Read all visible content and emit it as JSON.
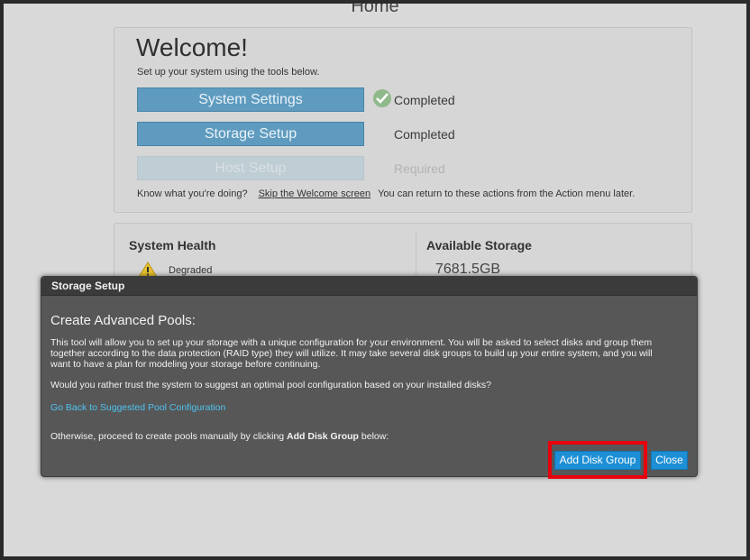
{
  "page": {
    "title": "Home"
  },
  "welcome": {
    "title": "Welcome!",
    "subtitle": "Set up your system using the tools below.",
    "actions": [
      {
        "label": "System Settings",
        "status": "Completed"
      },
      {
        "label": "Storage Setup",
        "status": "Completed"
      },
      {
        "label": "Host Setup",
        "status": "Required"
      }
    ],
    "footer": {
      "prompt": "Know what you're doing?",
      "skip_link": "Skip the Welcome screen",
      "note": "You can return to these actions from the Action menu later."
    }
  },
  "health": {
    "title": "System Health",
    "status": "Degraded"
  },
  "storage": {
    "title": "Available Storage",
    "value": "7681.5GB"
  },
  "modal": {
    "title": "Storage Setup",
    "heading": "Create Advanced Pools:",
    "paragraph": "This tool will allow you to set up your storage with a unique configuration for your environment. You will be asked to select disks and group them together according to the data protection (RAID type) they will utilize. It may take several disk groups to build up your entire system, and you will want to have a plan for modeling your storage before continuing.",
    "question": "Would you rather trust the system to suggest an optimal pool configuration based on your installed disks?",
    "back_link": "Go Back to Suggested Pool Configuration",
    "proceed_prefix": "Otherwise, proceed to create pools manually by clicking ",
    "proceed_bold": "Add Disk Group",
    "proceed_suffix": " below:",
    "add_button": "Add Disk Group",
    "close_button": "Close"
  },
  "colors": {
    "accent": "#1d8fd6",
    "highlight": "#e8000d",
    "link": "#4ec3f0"
  },
  "icons": {
    "completed": "check-circle-icon",
    "warning": "warning-triangle-icon"
  }
}
